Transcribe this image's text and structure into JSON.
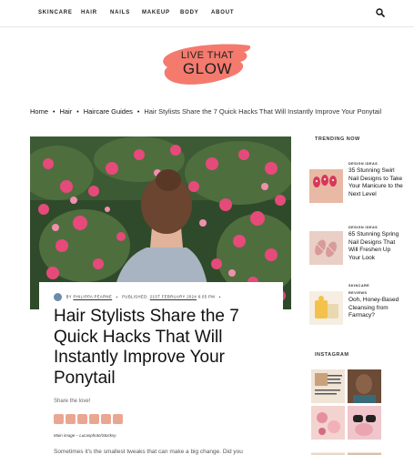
{
  "nav": {
    "items": [
      "SKINCARE",
      "HAIR",
      "NAILS",
      "MAKEUP",
      "BODY",
      "ABOUT"
    ]
  },
  "logo": {
    "line1": "LIVE THAT",
    "line2": "GLOW"
  },
  "breadcrumb": {
    "items": [
      "Home",
      "Hair",
      "Haircare Guides"
    ],
    "current": "Hair Stylists Share the 7 Quick Hacks That Will Instantly Improve Your Ponytail"
  },
  "article": {
    "by": "BY",
    "author": "PHILIPPA PEARNE",
    "published_label": "PUBLISHED:",
    "published_date": "21ST FEBRUARY 2024",
    "published_time": "6:05 PM",
    "title": "Hair Stylists Share the 7 Quick Hacks That Will Instantly Improve Your Ponytail",
    "share_label": "Share the love!",
    "image_credit": "Main image – Lucasphoto/Stocksy",
    "lead": "Sometimes it's the smallest tweaks that can make a big change. Did you"
  },
  "sidebar": {
    "trending_label": "TRENDING NOW",
    "instagram_label": "INSTAGRAM",
    "trending": [
      {
        "category": "DESIGN IDEAS",
        "subcategory": "",
        "title": "35 Stunning Swirl Nail Designs to Take Your Manicure to the Next Level"
      },
      {
        "category": "DESIGN IDEAS",
        "subcategory": "",
        "title": "65 Stunning Spring Nail Designs That Will Freshen Up Your Look"
      },
      {
        "category": "SKINCARE",
        "subcategory": "REVIEWS",
        "title": "Ooh, Honey-Based Cleansing from Farmacy?"
      }
    ]
  },
  "colors": {
    "logo_brush": "#f47a6e",
    "tag_highlight": "#e8c68e",
    "share_icon": "#e9a792"
  }
}
